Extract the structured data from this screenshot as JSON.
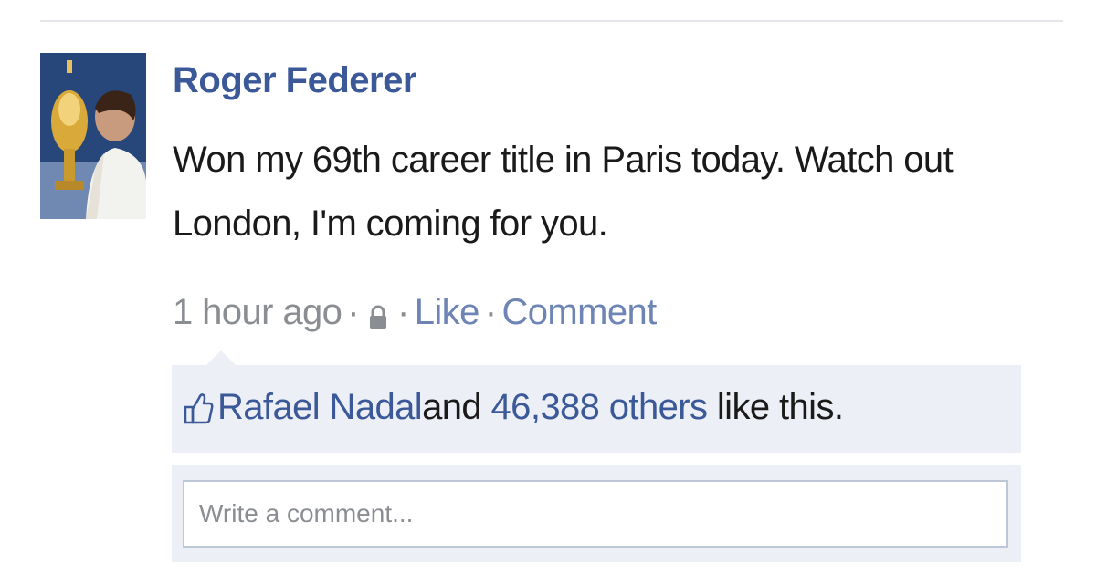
{
  "post": {
    "author": "Roger Federer",
    "text": "Won my 69th career title in Paris today. Watch out London, I'm coming for you.",
    "timestamp": "1 hour ago",
    "separator": "·",
    "privacy_icon": "lock-icon",
    "actions": {
      "like": "Like",
      "comment": "Comment"
    }
  },
  "likes": {
    "icon": "thumbs-up-icon",
    "first_name": "Rafael Nadal",
    "and_text": "and",
    "others_link": "46,388 others",
    "suffix": "like this."
  },
  "comment": {
    "placeholder": "Write a comment..."
  },
  "colors": {
    "link_blue": "#3b5998",
    "muted_link": "#6d84b4",
    "meta_gray": "#8a8d91",
    "panel_bg": "#eceff5",
    "input_border": "#bdc7d8"
  }
}
